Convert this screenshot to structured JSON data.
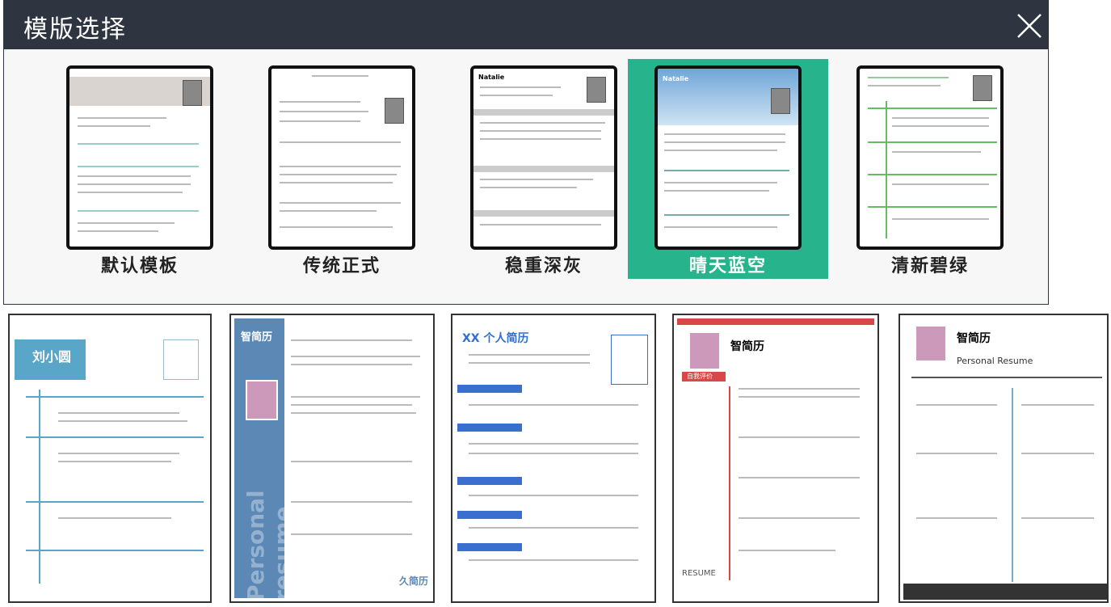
{
  "dialog": {
    "title": "模版选择",
    "close_icon": "close-icon"
  },
  "templates": [
    {
      "label": "默认模板",
      "selected": false
    },
    {
      "label": "传统正式",
      "selected": false
    },
    {
      "label": "稳重深灰",
      "selected": false
    },
    {
      "label": "晴天蓝空",
      "selected": true
    },
    {
      "label": "清新碧绿",
      "selected": false
    }
  ],
  "thumb_text": {
    "natalie_a": "Natalie",
    "natalie_b": "Natalie"
  },
  "bottom_templates": [
    {
      "name": "刘小圆"
    },
    {
      "name": "智简历",
      "vertical": "Personal resume",
      "brand": "久简历"
    },
    {
      "name": "XX 个人简历"
    },
    {
      "name": "智简历",
      "extra": "自我评价",
      "footer": "RESUME"
    },
    {
      "name": "智简历",
      "subtitle": "Personal Resume"
    }
  ],
  "colors": {
    "selected": "#27b38b",
    "titlebar": "#2e3440"
  }
}
